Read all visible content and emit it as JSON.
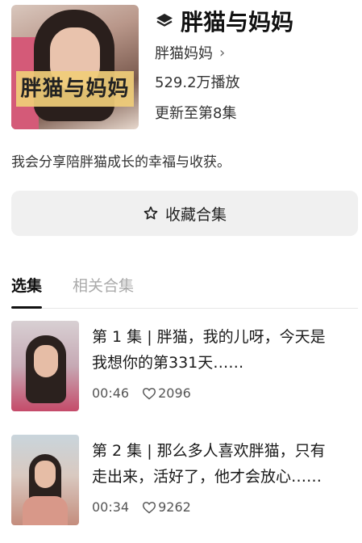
{
  "collection": {
    "cover_text": "胖猫与妈妈",
    "title": "胖猫与妈妈",
    "author": "胖猫妈妈",
    "plays": "529.2万播放",
    "update_status": "更新至第8集",
    "description": "我会分享陪胖猫成长的幸福与收获。"
  },
  "favorite_button": {
    "label": "收藏合集",
    "icon": "star-outline-icon"
  },
  "tabs": [
    {
      "label": "选集",
      "active": true
    },
    {
      "label": "相关合集",
      "active": false
    }
  ],
  "episodes": [
    {
      "title_line1": "第 1 集 | 胖猫，我的儿呀，今天是",
      "title_line2": "我想你的第331天……",
      "duration": "00:46",
      "likes": "2096"
    },
    {
      "title_line1": "第 2 集 | 那么多人喜欢胖猫，只有",
      "title_line2": "走出来，活好了，他才会放心……",
      "duration": "00:34",
      "likes": "9262"
    }
  ],
  "colors": {
    "button_bg": "#f0f0f0",
    "tab_inactive": "#aaaaaa",
    "text_primary": "#1a1a1a"
  }
}
